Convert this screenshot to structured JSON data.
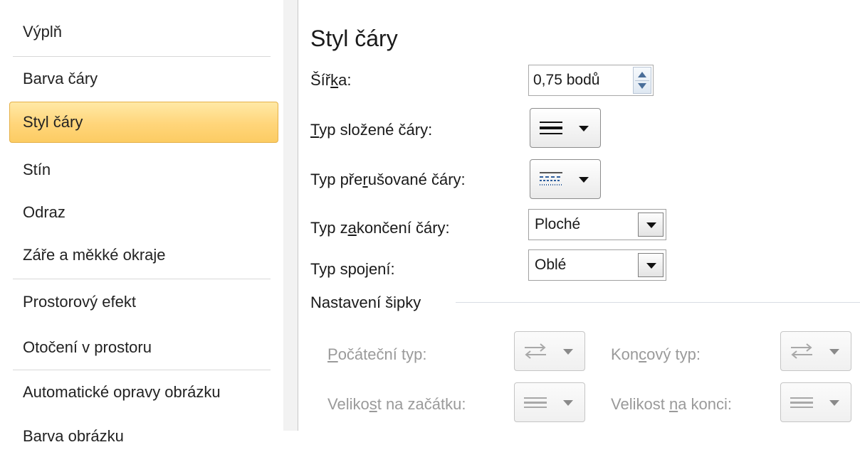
{
  "sidebar": {
    "items": [
      {
        "label": "Výplň"
      },
      {
        "label": "Barva čáry"
      },
      {
        "label": "Styl čáry",
        "selected": true
      },
      {
        "label": "Stín"
      },
      {
        "label": "Odraz"
      },
      {
        "label": "Záře a měkké okraje"
      },
      {
        "label": "Prostorový efekt"
      },
      {
        "label": "Otočení v prostoru"
      },
      {
        "label": "Automatické opravy obrázku"
      },
      {
        "label": "Barva obrázku"
      }
    ]
  },
  "panel": {
    "title": "Styl čáry",
    "width": {
      "label_pre": "Šíř",
      "label_u": "k",
      "label_post": "a:",
      "value": "0,75 bodů"
    },
    "compound_type": {
      "label_pre": "",
      "label_u": "T",
      "label_post": "yp složené čáry:",
      "icon": "compound-line-icon"
    },
    "dash_type": {
      "label_pre": "Typ pře",
      "label_u": "r",
      "label_post": "ušované čáry:",
      "icon": "dash-line-icon"
    },
    "cap_type": {
      "label_pre": "Typ z",
      "label_u": "a",
      "label_post": "končení čáry:",
      "value": "Ploché"
    },
    "join_type": {
      "label_pre": "Typ spo",
      "label_u": "j",
      "label_post": "ení:",
      "value": "Oblé"
    },
    "arrows": {
      "heading": "Nastavení šipky",
      "begin_type": {
        "label_pre": "",
        "label_u": "P",
        "label_post": "očáteční typ:",
        "icon": "arrow-type-icon"
      },
      "end_type": {
        "label_pre": "Kon",
        "label_u": "c",
        "label_post": "ový typ:",
        "icon": "arrow-type-icon"
      },
      "begin_size": {
        "label_pre": "Veliko",
        "label_u": "s",
        "label_post": "t na začátku:",
        "icon": "arrow-size-icon"
      },
      "end_size": {
        "label_pre": "Velikost ",
        "label_u": "n",
        "label_post": "a konci:",
        "icon": "arrow-size-icon"
      }
    }
  },
  "colors": {
    "selected_bg": "#ffd57a",
    "selected_border": "#e5b14a",
    "disabled_text": "#9a9a9a"
  }
}
